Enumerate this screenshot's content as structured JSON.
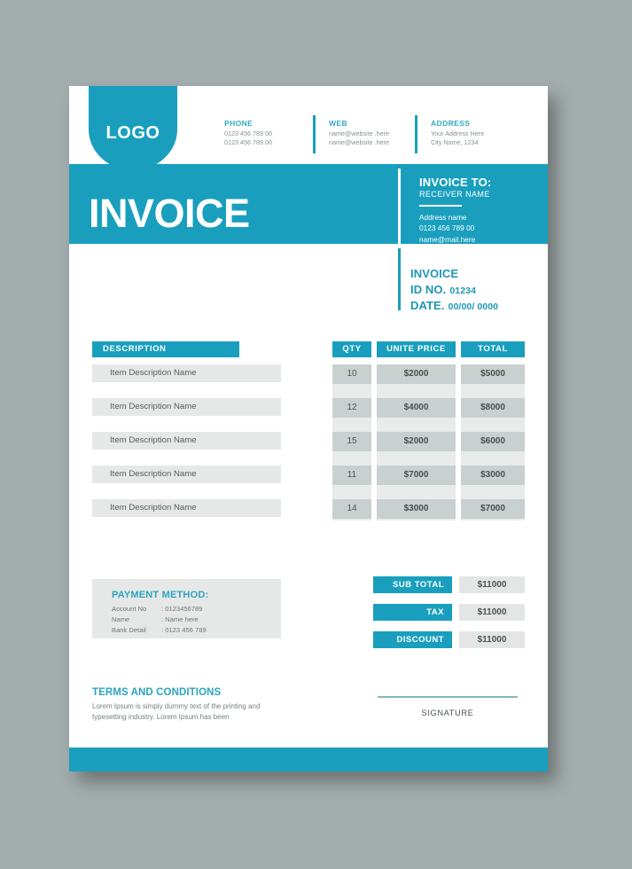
{
  "theme": {
    "brand_blue": "#199fbd",
    "brand_blue_text": "#2ba3bf",
    "page_bg": "#a3adad",
    "row_gray": "#e6e8e8",
    "band_gray": "#c8d0d0"
  },
  "header": {
    "logo_text": "LOGO",
    "contacts": [
      {
        "title": "PHONE",
        "lines": [
          "0123 456 789 00",
          "0123 456 789 00"
        ]
      },
      {
        "title": "WEB",
        "lines": [
          "name@website .here",
          "name@website .here"
        ]
      },
      {
        "title": "ADDRESS",
        "lines": [
          "Your Address Here",
          "City Name, 1234"
        ]
      }
    ]
  },
  "banner": {
    "heading": "INVOICE",
    "invoice_to": {
      "title": "INVOICE TO:",
      "receiver": "RECEIVER NAME",
      "lines": [
        "Address name",
        "0123 456 789 00",
        "name@mail.here"
      ]
    }
  },
  "meta": {
    "invoice_label": "INVOICE",
    "id_label": "ID NO.",
    "id_value": "01234",
    "date_label": "DATE.",
    "date_value": "00/00/ 0000"
  },
  "table": {
    "headers": {
      "description": "DESCRIPTION",
      "qty": "QTY",
      "price": "UNITE PRICE",
      "total": "TOTAL"
    },
    "rows": [
      {
        "description": "Item Description Name",
        "qty": "10",
        "price": "$2000",
        "total": "$5000"
      },
      {
        "description": "Item Description Name",
        "qty": "12",
        "price": "$4000",
        "total": "$8000"
      },
      {
        "description": "Item Description Name",
        "qty": "15",
        "price": "$2000",
        "total": "$6000"
      },
      {
        "description": "Item Description Name",
        "qty": "11",
        "price": "$7000",
        "total": "$3000"
      },
      {
        "description": "Item Description Name",
        "qty": "14",
        "price": "$3000",
        "total": "$7000"
      }
    ]
  },
  "payment": {
    "title": "PAYMENT METHOD:",
    "rows": [
      {
        "key": "Account No",
        "value": ": 0123456789"
      },
      {
        "key": "Name",
        "value": ": Name here"
      },
      {
        "key": "Bank Detail",
        "value": ": 0123 456 789"
      }
    ]
  },
  "totals": [
    {
      "label": "SUB TOTAL",
      "value": "$11000"
    },
    {
      "label": "TAX",
      "value": "$11000"
    },
    {
      "label": "DISCOUNT",
      "value": "$11000"
    }
  ],
  "terms": {
    "title": "TERMS AND CONDITIONS",
    "body": "Lorem Ipsum is simply dummy text of the printing and typesetting industry. Lorem Ipsum has been"
  },
  "signature": {
    "label": "SIGNATURE"
  }
}
